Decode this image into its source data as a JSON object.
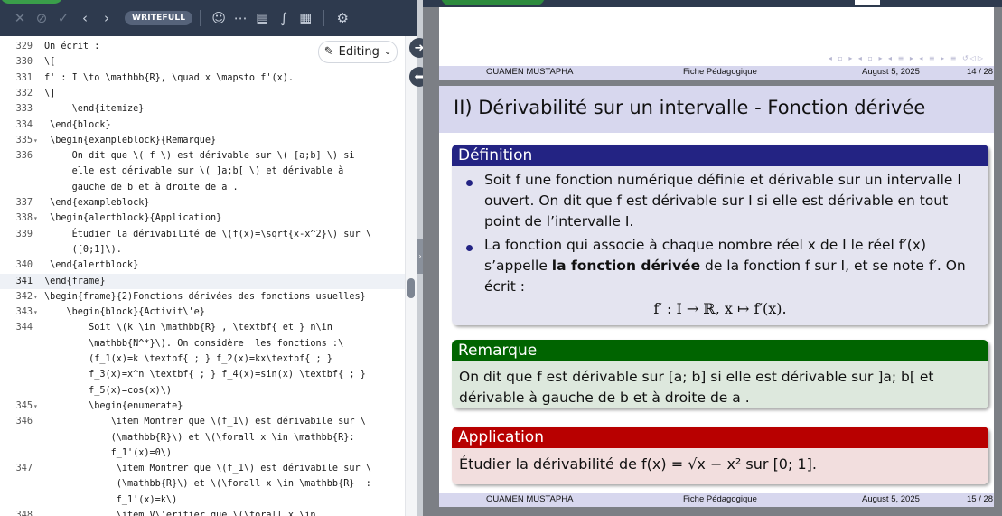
{
  "toolbar": {
    "writefull_label": "WRITEFULL",
    "icons": [
      "close-icon",
      "block-icon",
      "check-icon",
      "chevron-left-icon",
      "chevron-right-icon",
      "robot-icon",
      "ellipsis-icon",
      "document-icon",
      "integral-icon",
      "table-icon",
      "settings-icon"
    ]
  },
  "editor": {
    "mode_label": "Editing",
    "lines": [
      {
        "num": "329",
        "text": "On écrit :"
      },
      {
        "num": "330",
        "text": "\\["
      },
      {
        "num": "331",
        "text": "f' : I \\to \\mathbb{R}, \\quad x \\mapsto f'(x)."
      },
      {
        "num": "332",
        "text": "\\]"
      },
      {
        "num": "333",
        "text": "     \\end{itemize}"
      },
      {
        "num": "334",
        "text": " \\end{block}"
      },
      {
        "num": "335",
        "text": " \\begin{exampleblock}{Remarque}"
      },
      {
        "num": "336",
        "text": "     On dit que \\( f \\) est dérivable sur \\( [a;b] \\) si"
      },
      {
        "num": "",
        "text": "     elle est dérivable sur \\( ]a;b[ \\) et dérivable à"
      },
      {
        "num": "",
        "text": "     gauche de b et à droite de a ."
      },
      {
        "num": "337",
        "text": " \\end{exampleblock}"
      },
      {
        "num": "338",
        "text": " \\begin{alertblock}{Application}"
      },
      {
        "num": "339",
        "text": "     Étudier la dérivabilité de \\(f(x)=\\sqrt{x-x^2}\\) sur \\"
      },
      {
        "num": "",
        "text": "     ([0;1]\\)."
      },
      {
        "num": "340",
        "text": " \\end{alertblock}"
      },
      {
        "num": "341",
        "text": "\\end{frame}"
      },
      {
        "num": "342",
        "text": "\\begin{frame}{2)Fonctions dérivées des fonctions usuelles}"
      },
      {
        "num": "343",
        "text": "    \\begin{block}{Activit\\'e}"
      },
      {
        "num": "344",
        "text": "        Soit \\(k \\in \\mathbb{R} , \\textbf{ et } n\\in"
      },
      {
        "num": "",
        "text": "        \\mathbb{N^*}\\). On considère  les fonctions :\\"
      },
      {
        "num": "",
        "text": "        (f_1(x)=k \\textbf{ ; } f_2(x)=kx\\textbf{ ; }"
      },
      {
        "num": "",
        "text": "        f_3(x)=x^n \\textbf{ ; } f_4(x)=sin(x) \\textbf{ ; }"
      },
      {
        "num": "",
        "text": "        f_5(x)=cos(x)\\)"
      },
      {
        "num": "345",
        "text": "        \\begin{enumerate}"
      },
      {
        "num": "346",
        "text": "            \\item Montrer que \\(f_1\\) est dérivabile sur \\"
      },
      {
        "num": "",
        "text": "            (\\mathbb{R}\\) et \\(\\forall x \\in \\mathbb{R}:"
      },
      {
        "num": "",
        "text": "            f_1'(x)=0\\)"
      },
      {
        "num": "347",
        "text": "             \\item Montrer que \\(f_1\\) est dérivabile sur \\"
      },
      {
        "num": "",
        "text": "             (\\mathbb{R}\\) et \\(\\forall x \\in \\mathbb{R}  :"
      },
      {
        "num": "",
        "text": "             f_1'(x)=k\\)"
      },
      {
        "num": "348",
        "text": "             \\item V\\'erifier que \\(\\forall x \\in"
      }
    ]
  },
  "pdf": {
    "page14": {
      "author": "OUAMEN MUSTAPHA",
      "middle": "Fiche Pédagogique",
      "date": "August 5, 2025",
      "page": "14 / 28"
    },
    "page15": {
      "frametitle": "II) Dérivabilité sur un intervalle - Fonction dérivée",
      "definition": {
        "title": "Définition",
        "item1_line1": "Soit f une fonction numérique définie et dérivable sur un intervalle I",
        "item1_line2": "ouvert. On dit que f est dérivable sur I si elle est dérivable en tout",
        "item1_line3": "point de l’intervalle I.",
        "item2_line1": "La fonction qui associe à chaque nombre réel x de I le réel f′(x)",
        "item2_line2a": "s’appelle ",
        "item2_line2b": "la fonction dérivée",
        "item2_line2c": " de la fonction f sur I, et se note f′. On",
        "item2_line3": "écrit :",
        "formula": "f′ : I → ℝ,    x ↦ f′(x)."
      },
      "remark": {
        "title": "Remarque",
        "line1": "On dit que f est dérivable sur [a; b] si elle est dérivable sur ]a; b[ et",
        "line2": "dérivable à gauche de b et à droite de a ."
      },
      "application": {
        "title": "Application",
        "text": "Étudier la dérivabilité de f(x) = √x − x² sur [0; 1]."
      },
      "author": "OUAMEN MUSTAPHA",
      "middle": "Fiche Pédagogique",
      "date": "August 5, 2025",
      "page": "15 / 28"
    }
  }
}
